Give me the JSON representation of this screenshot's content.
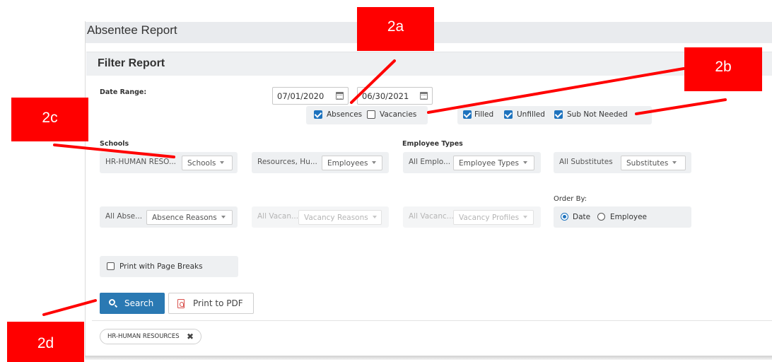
{
  "page": {
    "title": "Absentee Report",
    "filter_title": "Filter Report"
  },
  "date_range": {
    "label": "Date Range:",
    "start": "07/01/2020",
    "end": "06/30/2021"
  },
  "type_checks": [
    {
      "label": "Absences",
      "checked": true
    },
    {
      "label": "Vacancies",
      "checked": false
    }
  ],
  "status_checks": [
    {
      "label": "Filled",
      "checked": true
    },
    {
      "label": "Unfilled",
      "checked": true
    },
    {
      "label": "Sub Not Needed",
      "checked": true
    }
  ],
  "schools": {
    "label": "Schools",
    "value": "HR-HUMAN RESO...",
    "button": "Schools"
  },
  "employees": {
    "value": "Resources, Hu...",
    "button": "Employees"
  },
  "employee_types": {
    "label": "Employee Types",
    "value": "All Emplo...",
    "button": "Employee Types"
  },
  "substitutes": {
    "value": "All Substitutes",
    "button": "Substitutes"
  },
  "absence_reasons": {
    "value": "All Abse...",
    "button": "Absence Reasons"
  },
  "vacancy_reasons": {
    "value": "All Vacan...",
    "button": "Vacancy Reasons"
  },
  "vacancy_profiles": {
    "value": "All Vacanc...",
    "button": "Vacancy Profiles"
  },
  "order_by": {
    "label": "Order By:",
    "options": [
      {
        "label": "Date",
        "selected": true
      },
      {
        "label": "Employee",
        "selected": false
      }
    ]
  },
  "print_page_breaks": {
    "label": "Print with Page Breaks",
    "checked": false
  },
  "buttons": {
    "search": "Search",
    "pdf": "Print to PDF"
  },
  "filter_tag": {
    "label": "HR-HUMAN RESOURCES",
    "remove": "✖"
  },
  "callouts": {
    "c2a": "2a",
    "c2b": "2b",
    "c2c": "2c",
    "c2d": "2d"
  },
  "accent": "#ff0000",
  "primary": "#2a79b3"
}
